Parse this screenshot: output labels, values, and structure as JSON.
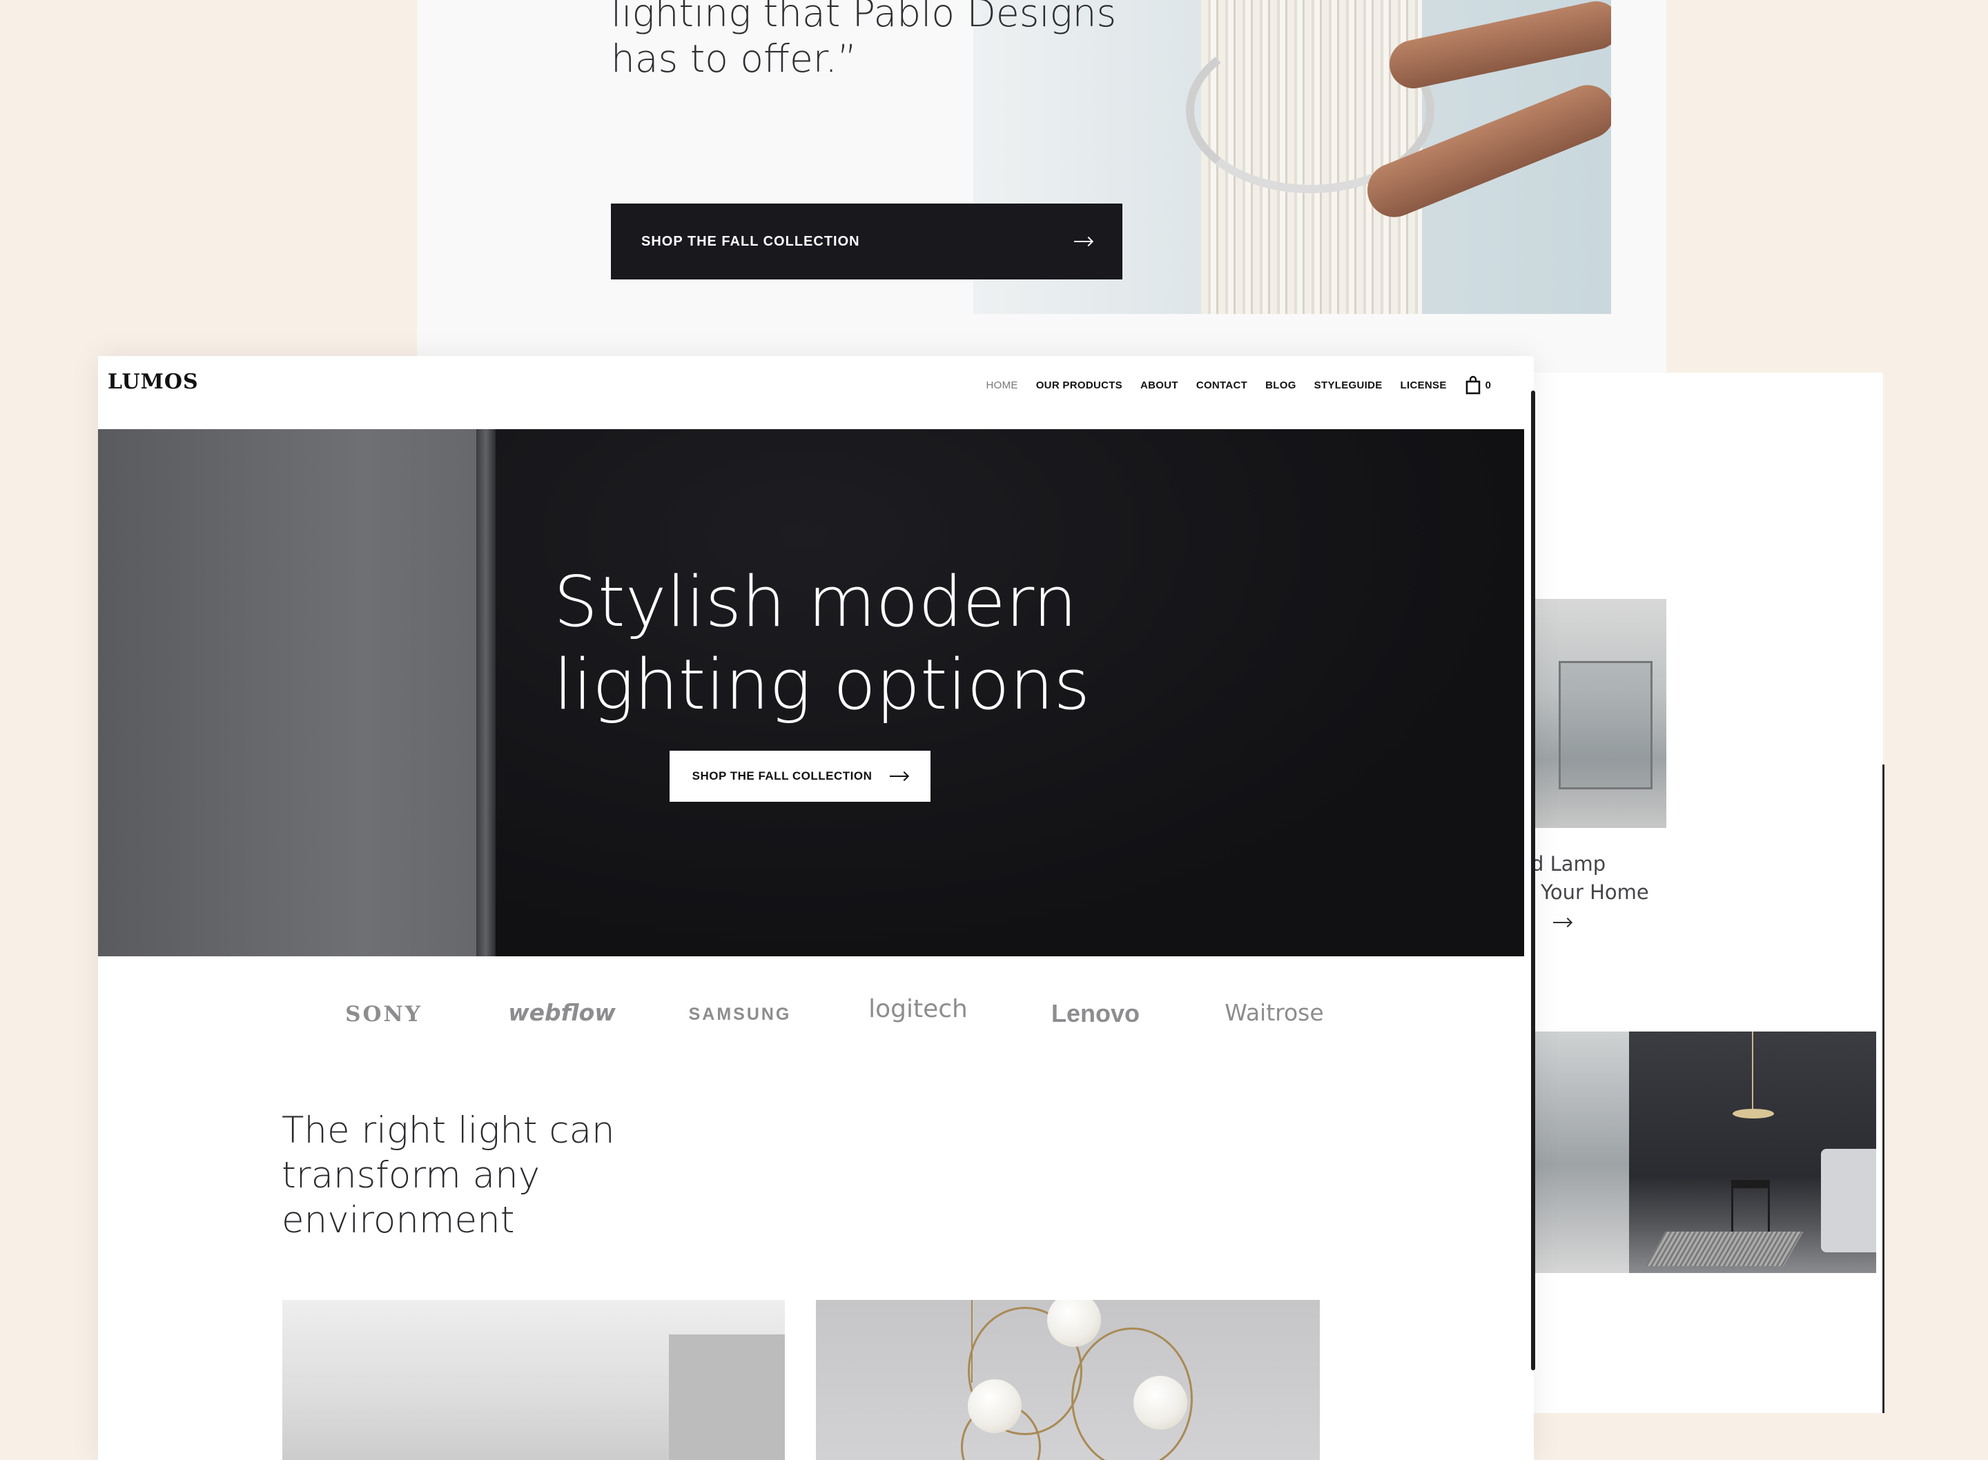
{
  "back_card": {
    "quote": "lighting that Pablo Designs has to offer.”",
    "cta_label": "SHOP THE FALL COLLECTION"
  },
  "right_card": {
    "product_title": "d Lamp\n Your Home",
    "product_title_line1": "d Lamp",
    "product_title_line2": "Your Home"
  },
  "nav": {
    "logo": "LUMOS",
    "links": [
      "HOME",
      "OUR PRODUCTS",
      "ABOUT",
      "CONTACT",
      "BLOG",
      "STYLEGUIDE",
      "LICENSE"
    ],
    "active": "HOME",
    "cart_count": "0"
  },
  "hero": {
    "title": "Stylish modern lighting options",
    "cta_label": "SHOP THE FALL COLLECTION"
  },
  "brands": [
    "SONY",
    "webflow",
    "SAMSUNG",
    "logitech",
    "Lenovo",
    "Waitrose"
  ],
  "section": {
    "title": "The right light can transform any environment"
  },
  "colors": {
    "page_background": "#f8efe6",
    "dark_button": "#18181d",
    "hero_background": "#141416",
    "brand_gray": "#8d8d90"
  },
  "icons": {
    "cart": "shopping-bag-icon",
    "arrow": "arrow-right-icon"
  }
}
